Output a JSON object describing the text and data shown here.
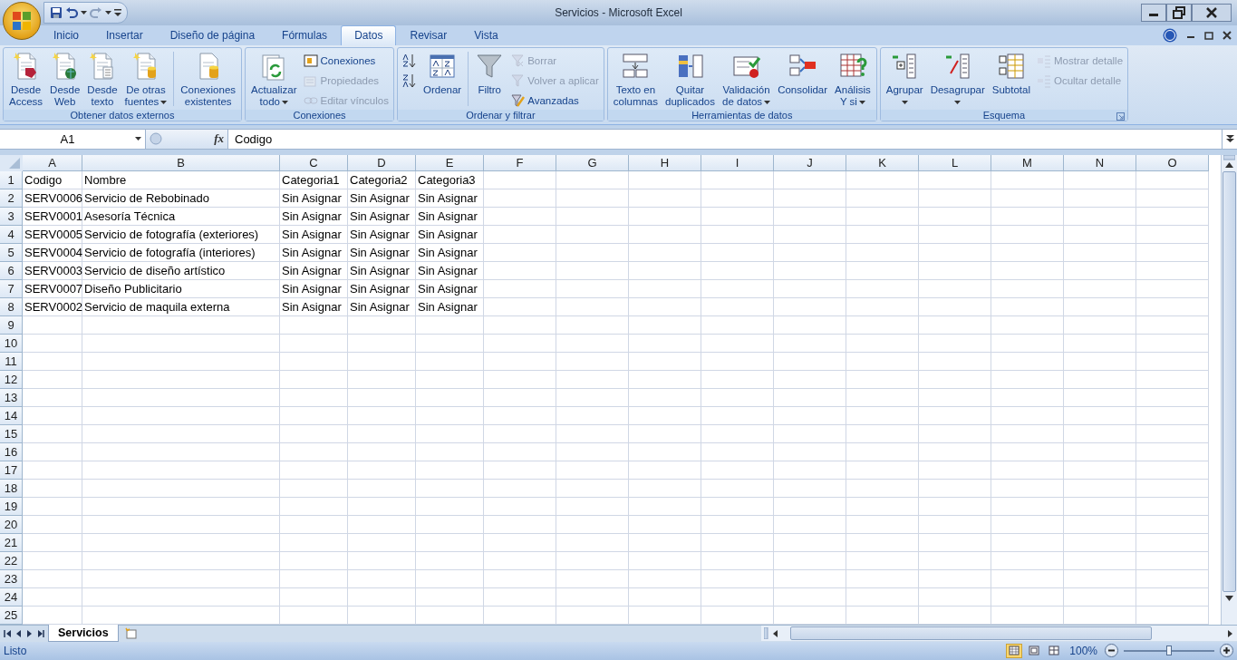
{
  "window": {
    "title": "Servicios - Microsoft Excel"
  },
  "tabs": [
    {
      "label": "Inicio",
      "selected": false
    },
    {
      "label": "Insertar",
      "selected": false
    },
    {
      "label": "Diseño de página",
      "selected": false
    },
    {
      "label": "Fórmulas",
      "selected": false
    },
    {
      "label": "Datos",
      "selected": true
    },
    {
      "label": "Revisar",
      "selected": false
    },
    {
      "label": "Vista",
      "selected": false
    }
  ],
  "ribbon_groups": [
    {
      "label": "Obtener datos externos",
      "launcher": false,
      "items": [
        {
          "kind": "large",
          "label": "Desde\nAccess",
          "disabled": false,
          "dropdown": false
        },
        {
          "kind": "large",
          "label": "Desde\nWeb",
          "disabled": false,
          "dropdown": false
        },
        {
          "kind": "large",
          "label": "Desde\ntexto",
          "disabled": false,
          "dropdown": false
        },
        {
          "kind": "large",
          "label": "De otras\nfuentes",
          "disabled": false,
          "dropdown": true
        },
        {
          "kind": "separator"
        },
        {
          "kind": "large",
          "label": "Conexiones\nexistentes",
          "disabled": false,
          "dropdown": false
        }
      ]
    },
    {
      "label": "Conexiones",
      "launcher": false,
      "items": [
        {
          "kind": "large",
          "label": "Actualizar\ntodo",
          "disabled": false,
          "dropdown": true
        },
        {
          "kind": "small",
          "label": "Conexiones",
          "disabled": false
        },
        {
          "kind": "small",
          "label": "Propiedades",
          "disabled": true
        },
        {
          "kind": "small",
          "label": "Editar vínculos",
          "disabled": true
        }
      ]
    },
    {
      "label": "Ordenar y filtrar",
      "launcher": false,
      "items": [
        {
          "kind": "small",
          "disabled": false
        },
        {
          "kind": "small",
          "disabled": false
        },
        {
          "kind": "large",
          "label": "Ordenar",
          "disabled": false,
          "dropdown": false
        },
        {
          "kind": "separator"
        },
        {
          "kind": "large",
          "label": "Filtro",
          "disabled": false,
          "dropdown": false
        },
        {
          "kind": "small",
          "label": "Borrar",
          "disabled": true
        },
        {
          "kind": "small",
          "label": "Volver a aplicar",
          "disabled": true
        },
        {
          "kind": "small",
          "label": "Avanzadas",
          "disabled": false
        }
      ]
    },
    {
      "label": "Herramientas de datos",
      "launcher": false,
      "items": [
        {
          "kind": "large",
          "label": "Texto en\ncolumnas",
          "disabled": false,
          "dropdown": false
        },
        {
          "kind": "large",
          "label": "Quitar\nduplicados",
          "disabled": false,
          "dropdown": false
        },
        {
          "kind": "large",
          "label": "Validación\nde datos",
          "disabled": false,
          "dropdown": true
        },
        {
          "kind": "large",
          "label": "Consolidar",
          "disabled": false,
          "dropdown": false
        },
        {
          "kind": "large",
          "label": "Análisis\nY si",
          "disabled": false,
          "dropdown": true
        }
      ]
    },
    {
      "label": "Esquema",
      "launcher": true,
      "items": [
        {
          "kind": "large",
          "label": "Agrupar",
          "disabled": false,
          "dropdown": true
        },
        {
          "kind": "large",
          "label": "Desagrupar",
          "disabled": false,
          "dropdown": true
        },
        {
          "kind": "large",
          "label": "Subtotal",
          "disabled": false,
          "dropdown": false
        },
        {
          "kind": "small",
          "label": "Mostrar detalle",
          "disabled": true
        },
        {
          "kind": "small",
          "label": "Ocultar detalle",
          "disabled": true
        }
      ]
    }
  ],
  "formula_bar": {
    "name_box": "A1",
    "function_label": "fx",
    "value": "Codigo"
  },
  "sheet": {
    "columns": [
      "A",
      "B",
      "C",
      "D",
      "E",
      "F",
      "G",
      "H",
      "I",
      "J",
      "K",
      "L",
      "M",
      "N",
      "O"
    ],
    "row_numbers": [
      "1",
      "2",
      "3",
      "4",
      "5",
      "6",
      "7",
      "8",
      "9",
      "10",
      "11",
      "12",
      "13",
      "14",
      "15",
      "16",
      "17",
      "18",
      "19",
      "20",
      "21",
      "22",
      "23",
      "24",
      "25"
    ],
    "rows": [
      [
        "Codigo",
        "Nombre",
        "Categoria1",
        "Categoria2",
        "Categoria3"
      ],
      [
        "SERV0006",
        "Servicio de Rebobinado",
        "Sin Asignar",
        "Sin Asignar",
        "Sin Asignar"
      ],
      [
        "SERV0001",
        "Asesoría Técnica",
        "Sin Asignar",
        "Sin Asignar",
        "Sin Asignar"
      ],
      [
        "SERV0005",
        "Servicio de fotografía (exteriores)",
        "Sin Asignar",
        "Sin Asignar",
        "Sin Asignar"
      ],
      [
        "SERV0004",
        "Servicio de fotografía (interiores)",
        "Sin Asignar",
        "Sin Asignar",
        "Sin Asignar"
      ],
      [
        "SERV0003",
        "Servicio de diseño artístico",
        "Sin Asignar",
        "Sin Asignar",
        "Sin Asignar"
      ],
      [
        "SERV0007",
        "Diseño Publicitario",
        "Sin Asignar",
        "Sin Asignar",
        "Sin Asignar"
      ],
      [
        "SERV0002",
        "Servicio de maquila externa",
        "Sin Asignar",
        "Sin Asignar",
        "Sin Asignar"
      ]
    ]
  },
  "sheet_tabs": [
    {
      "label": "Servicios",
      "selected": true
    }
  ],
  "status_bar": {
    "status": "Listo",
    "views": [
      {
        "selected": true
      },
      {
        "selected": false
      },
      {
        "selected": false
      }
    ],
    "zoom": "100%",
    "zoom_level": {
      "level": 0.5
    }
  }
}
